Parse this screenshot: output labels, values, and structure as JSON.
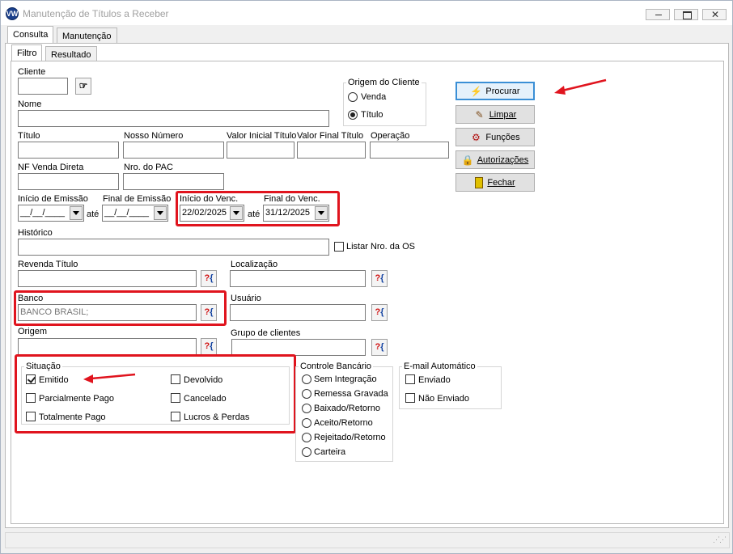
{
  "window": {
    "title": "Manutenção de Títulos a Receber",
    "logo_text": "VW",
    "buttons": [
      "minimize",
      "restore",
      "close"
    ]
  },
  "tabs": [
    {
      "label": "Consulta",
      "active": true
    },
    {
      "label": "Manutenção",
      "active": false
    }
  ],
  "subtabs": [
    {
      "label": "Filtro",
      "active": true
    },
    {
      "label": "Resultado",
      "active": false
    }
  ],
  "fields": {
    "cliente": {
      "label": "Cliente",
      "value": ""
    },
    "nome": {
      "label": "Nome",
      "value": ""
    },
    "titulo": {
      "label": "Título",
      "value": ""
    },
    "nosso_numero": {
      "label": "Nosso Número",
      "value": ""
    },
    "valor_inicial": {
      "label": "Valor Inicial Título",
      "value": ""
    },
    "valor_final": {
      "label": "Valor Final Título",
      "value": ""
    },
    "operacao": {
      "label": "Operação",
      "value": ""
    },
    "nf_venda": {
      "label": "NF Venda Direta",
      "value": ""
    },
    "nro_pac": {
      "label": "Nro. do PAC",
      "value": ""
    },
    "inicio_emissao": {
      "label": "Início de Emissão",
      "value": "__/__/____"
    },
    "final_emissao": {
      "label": "Final de Emissão",
      "value": "__/__/____"
    },
    "inicio_venc": {
      "label": "Início do Venc.",
      "value": "22/02/2025"
    },
    "final_venc": {
      "label": "Final do Venc.",
      "value": "31/12/2025"
    },
    "ate": "até",
    "historico": {
      "label": "Histórico",
      "value": ""
    },
    "listar_os": {
      "label": "Listar Nro. da OS",
      "checked": false
    },
    "revenda": {
      "label": "Revenda Título",
      "value": ""
    },
    "localizacao": {
      "label": "Localização",
      "value": ""
    },
    "banco": {
      "label": "Banco",
      "value": "BANCO BRASIL;"
    },
    "usuario": {
      "label": "Usuário",
      "value": ""
    },
    "origem": {
      "label": "Origem",
      "value": ""
    },
    "grupo_clientes": {
      "label": "Grupo de clientes",
      "value": ""
    }
  },
  "origem_cliente": {
    "title": "Origem do Cliente",
    "options": [
      {
        "label": "Venda",
        "selected": false
      },
      {
        "label": "Título",
        "selected": true
      }
    ]
  },
  "situacao": {
    "title": "Situação",
    "options": [
      {
        "label": "Emitido",
        "checked": true
      },
      {
        "label": "Parcialmente Pago",
        "checked": false
      },
      {
        "label": "Totalmente Pago",
        "checked": false
      },
      {
        "label": "Devolvido",
        "checked": false
      },
      {
        "label": "Cancelado",
        "checked": false
      },
      {
        "label": "Lucros & Perdas",
        "checked": false
      }
    ]
  },
  "controle_bancario": {
    "title": "Controle Bancário",
    "options": [
      {
        "label": "Sem Integração",
        "selected": false
      },
      {
        "label": "Remessa Gravada",
        "selected": false
      },
      {
        "label": "Baixado/Retorno",
        "selected": false
      },
      {
        "label": "Aceito/Retorno",
        "selected": false
      },
      {
        "label": "Rejeitado/Retorno",
        "selected": false
      },
      {
        "label": "Carteira",
        "selected": false
      }
    ]
  },
  "email_automatico": {
    "title": "E-mail Automático",
    "options": [
      {
        "label": "Enviado",
        "checked": false
      },
      {
        "label": "Não Enviado",
        "checked": false
      }
    ]
  },
  "actions": {
    "procurar": {
      "label": "Procurar",
      "icon": "lightning-icon"
    },
    "limpar": {
      "label": "Limpar",
      "icon": "broom-icon"
    },
    "funcoes": {
      "label": "Funções",
      "icon": "functions-icon"
    },
    "autorizacoes": {
      "label": "Autorizações",
      "icon": "lock-icon"
    },
    "fechar": {
      "label": "Fechar",
      "icon": "door-icon"
    }
  },
  "lookup_icon": {
    "q": "?",
    "b": "{"
  },
  "colors": {
    "highlight": "#e0141e",
    "focus_border": "#3a8fd6"
  }
}
